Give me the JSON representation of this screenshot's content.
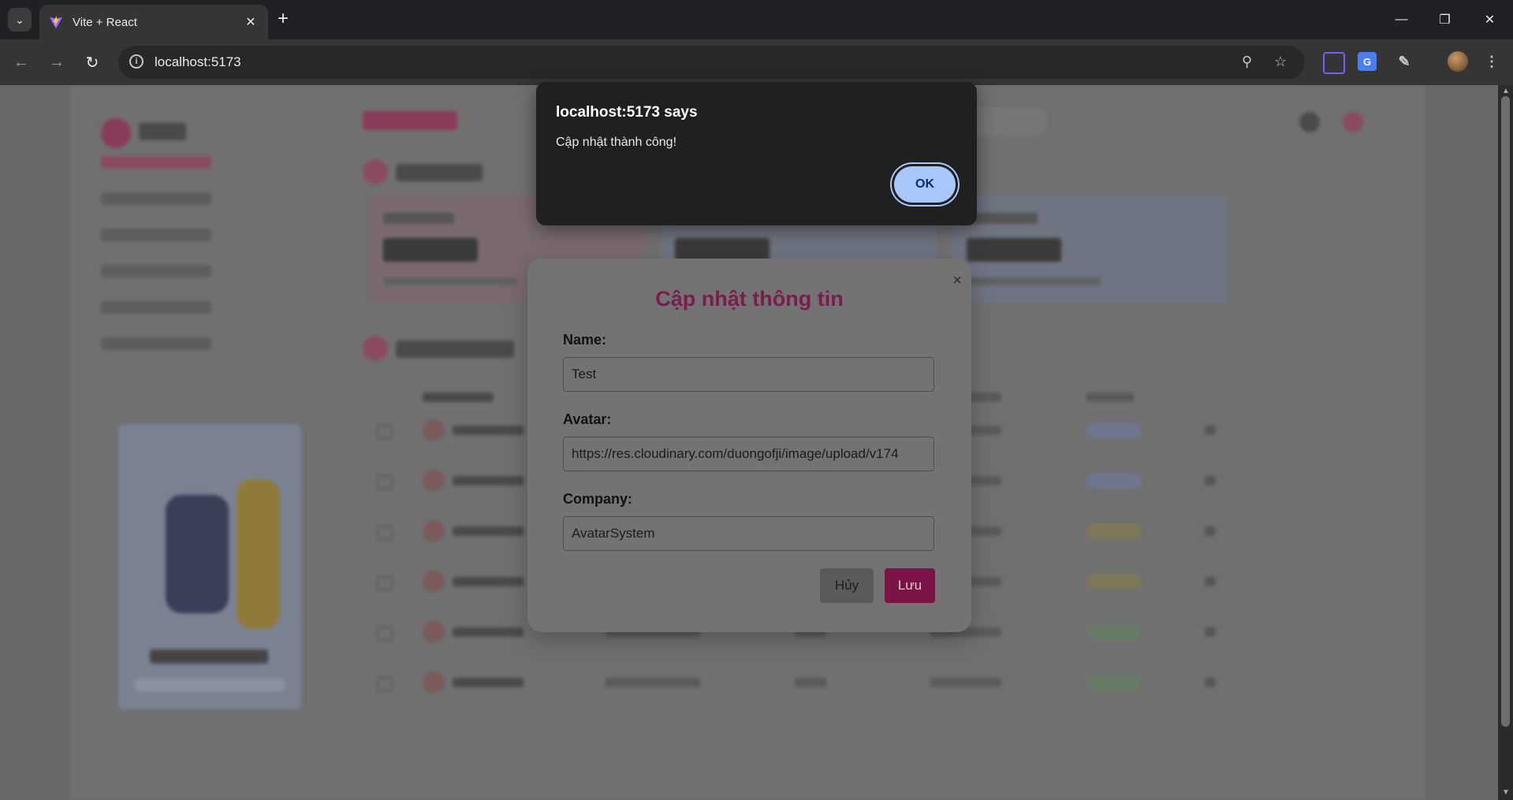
{
  "browser": {
    "tab_title": "Vite + React",
    "url": "localhost:5173"
  },
  "alert": {
    "title": "localhost:5173 says",
    "message": "Cập nhật thành công!",
    "ok_label": "OK"
  },
  "modal": {
    "title": "Cập nhật thông tin",
    "close_symbol": "×",
    "fields": {
      "name": {
        "label": "Name:",
        "value": "Test"
      },
      "avatar": {
        "label": "Avatar:",
        "value": "https://res.cloudinary.com/duongofji/image/upload/v174"
      },
      "company": {
        "label": "Company:",
        "value": "AvatarSystem"
      }
    },
    "cancel_label": "Hủy",
    "save_label": "Lưu"
  },
  "colors": {
    "accent": "#7a1346",
    "ok_button": "#a8c7fa",
    "alert_bg": "#202020"
  },
  "icons": [
    "tab-search-icon",
    "vite-favicon",
    "close-icon",
    "plus-icon",
    "minimize-icon",
    "restore-icon",
    "window-close-icon",
    "back-icon",
    "forward-icon",
    "reload-icon",
    "site-info-icon",
    "zoom-out-icon",
    "star-icon",
    "screenshot-extension-icon",
    "translate-extension-icon",
    "extensions-icon",
    "profile-avatar",
    "more-menu-icon"
  ]
}
